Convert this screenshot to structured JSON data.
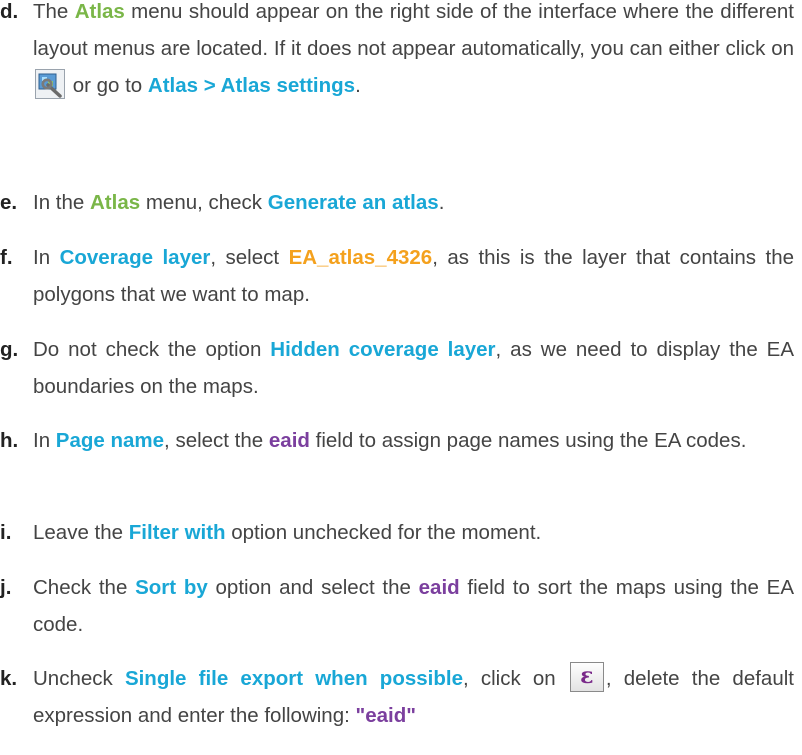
{
  "steps": [
    {
      "marker": "d.",
      "parts": [
        {
          "t": "The "
        },
        {
          "t": "Atlas",
          "c": "green"
        },
        {
          "t": " menu should appear on the right side of the interface where the different layout menus are located. If it does not appear automatically, you can either click on "
        },
        {
          "icon": "atlas-settings-icon"
        },
        {
          "t": " or go to "
        },
        {
          "t": "Atlas > Atlas settings",
          "c": "blue"
        },
        {
          "t": "."
        }
      ]
    },
    {
      "marker": "e.",
      "parts": [
        {
          "t": "In the "
        },
        {
          "t": "Atlas",
          "c": "green"
        },
        {
          "t": " menu, check "
        },
        {
          "t": "Generate an atlas",
          "c": "blue"
        },
        {
          "t": "."
        }
      ]
    },
    {
      "marker": "f.",
      "parts": [
        {
          "t": "In "
        },
        {
          "t": "Coverage layer",
          "c": "blue"
        },
        {
          "t": ", select "
        },
        {
          "t": "EA_atlas_4326",
          "c": "orange"
        },
        {
          "t": ", as this is the layer that contains the polygons that we want to map."
        }
      ]
    },
    {
      "marker": "g.",
      "parts": [
        {
          "t": "Do not check the option "
        },
        {
          "t": "Hidden coverage layer",
          "c": "blue"
        },
        {
          "t": ", as we need to display the EA boundaries on the maps."
        }
      ]
    },
    {
      "marker": "h.",
      "parts": [
        {
          "t": "In "
        },
        {
          "t": "Page name",
          "c": "blue"
        },
        {
          "t": ", select the "
        },
        {
          "t": "eaid",
          "c": "purple"
        },
        {
          "t": " field to assign page names using the EA codes."
        }
      ]
    },
    {
      "marker": "i.",
      "parts": [
        {
          "t": "Leave the "
        },
        {
          "t": "Filter with",
          "c": "blue"
        },
        {
          "t": " option unchecked for the moment."
        }
      ]
    },
    {
      "marker": "j.",
      "parts": [
        {
          "t": "Check the "
        },
        {
          "t": "Sort by",
          "c": "blue"
        },
        {
          "t": " option and select the "
        },
        {
          "t": "eaid",
          "c": "purple"
        },
        {
          "t": " field to sort the maps using the EA code."
        }
      ]
    },
    {
      "marker": "k.",
      "parts": [
        {
          "t": "Uncheck "
        },
        {
          "t": "Single file export when possible",
          "c": "blue"
        },
        {
          "t": ", click on "
        },
        {
          "icon": "expression-epsilon-icon",
          "glyph": "ε"
        },
        {
          "t": ", delete the default expression and enter the following: "
        },
        {
          "t": "\"eaid\"",
          "c": "purple"
        }
      ]
    }
  ]
}
